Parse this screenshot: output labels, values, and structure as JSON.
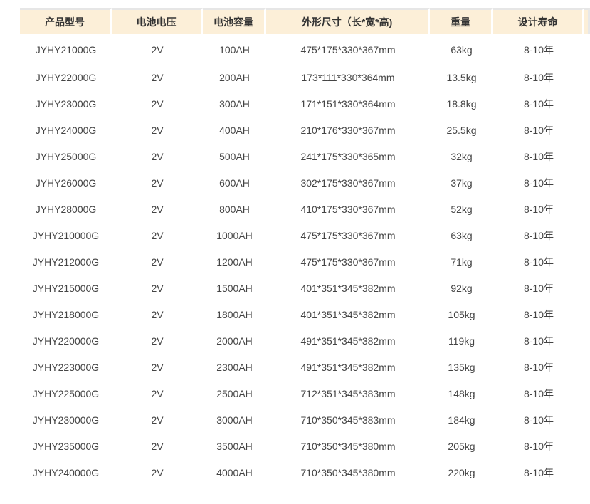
{
  "table": {
    "headers": [
      "产品型号",
      "电池电压",
      "电池容量",
      "外形尺寸（长*宽*高)",
      "重量",
      "设计寿命"
    ],
    "rows": [
      [
        "JYHY21000G",
        "2V",
        "100AH",
        "475*175*330*367mm",
        "63kg",
        "8-10年"
      ],
      [
        "JYHY22000G",
        "2V",
        "200AH",
        "173*111*330*364mm",
        "13.5kg",
        "8-10年"
      ],
      [
        "JYHY23000G",
        "2V",
        "300AH",
        "171*151*330*364mm",
        "18.8kg",
        "8-10年"
      ],
      [
        "JYHY24000G",
        "2V",
        "400AH",
        "210*176*330*367mm",
        "25.5kg",
        "8-10年"
      ],
      [
        "JYHY25000G",
        "2V",
        "500AH",
        "241*175*330*365mm",
        "32kg",
        "8-10年"
      ],
      [
        "JYHY26000G",
        "2V",
        "600AH",
        "302*175*330*367mm",
        "37kg",
        "8-10年"
      ],
      [
        "JYHY28000G",
        "2V",
        "800AH",
        "410*175*330*367mm",
        "52kg",
        "8-10年"
      ],
      [
        "JYHY210000G",
        "2V",
        "1000AH",
        "475*175*330*367mm",
        "63kg",
        "8-10年"
      ],
      [
        "JYHY212000G",
        "2V",
        "1200AH",
        "475*175*330*367mm",
        "71kg",
        "8-10年"
      ],
      [
        "JYHY215000G",
        "2V",
        "1500AH",
        "401*351*345*382mm",
        "92kg",
        "8-10年"
      ],
      [
        "JYHY218000G",
        "2V",
        "1800AH",
        "401*351*345*382mm",
        "105kg",
        "8-10年"
      ],
      [
        "JYHY220000G",
        "2V",
        "2000AH",
        "491*351*345*382mm",
        "119kg",
        "8-10年"
      ],
      [
        "JYHY223000G",
        "2V",
        "2300AH",
        "491*351*345*382mm",
        "135kg",
        "8-10年"
      ],
      [
        "JYHY225000G",
        "2V",
        "2500AH",
        "712*351*345*383mm",
        "148kg",
        "8-10年"
      ],
      [
        "JYHY230000G",
        "2V",
        "3000AH",
        "710*350*345*383mm",
        "184kg",
        "8-10年"
      ],
      [
        "JYHY235000G",
        "2V",
        "3500AH",
        "710*350*345*380mm",
        "205kg",
        "8-10年"
      ],
      [
        "JYHY240000G",
        "2V",
        "4000AH",
        "710*350*345*380mm",
        "220kg",
        "8-10年"
      ]
    ]
  },
  "colors": {
    "header_bg": "#fcefd8",
    "text": "#444444"
  }
}
